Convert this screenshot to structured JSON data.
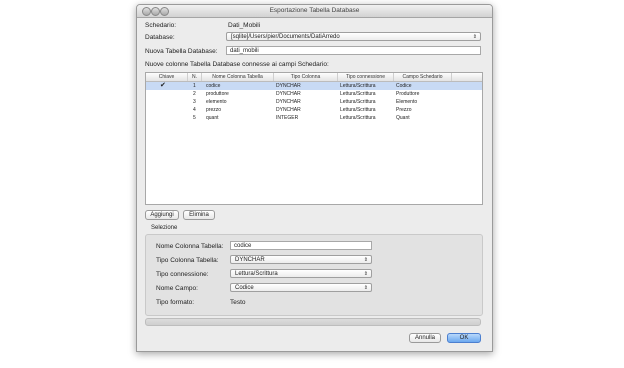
{
  "window": {
    "title": "Esportazione Tabella Database"
  },
  "form": {
    "schedario_label": "Schedario:",
    "schedario_value": "Dati_Mobili",
    "database_label": "Database:",
    "database_value": "[sqlite]/Users/pier/Documents/DatiArredo",
    "new_table_label": "Nuova Tabella Database:",
    "new_table_value": "dati_mobili",
    "columns_caption": "Nuove colonne Tabella Database connesse ai campi Schedario:"
  },
  "table": {
    "headers": [
      "Chiave",
      "N.",
      "Nome Colonna Tabella",
      "Tipo Colonna",
      "Tipo connessione",
      "Campo Schedario"
    ],
    "rows": [
      {
        "key": "✔",
        "n": "1",
        "name": "codice",
        "type": "DYNCHAR",
        "conn": "Lettura/Scrittura",
        "field": "Codice"
      },
      {
        "key": "",
        "n": "2",
        "name": "produttore",
        "type": "DYNCHAR",
        "conn": "Lettura/Scrittura",
        "field": "Produttore"
      },
      {
        "key": "",
        "n": "3",
        "name": "elemento",
        "type": "DYNCHAR",
        "conn": "Lettura/Scrittura",
        "field": "Elemento"
      },
      {
        "key": "",
        "n": "4",
        "name": "prezzo",
        "type": "DYNCHAR",
        "conn": "Lettura/Scrittura",
        "field": "Prezzo"
      },
      {
        "key": "",
        "n": "5",
        "name": "quant",
        "type": "INTEGER",
        "conn": "Lettura/Scrittura",
        "field": "Quant"
      }
    ],
    "selected_row": 0
  },
  "buttons": {
    "add": "Aggiungi",
    "remove": "Elimina",
    "cancel": "Annulla",
    "ok": "OK"
  },
  "selection": {
    "title": "Selezione",
    "col_name_label": "Nome Colonna Tabella:",
    "col_name_value": "codice",
    "col_type_label": "Tipo Colonna Tabella:",
    "col_type_value": "DYNCHAR",
    "conn_type_label": "Tipo connessione:",
    "conn_type_value": "Lettura/Scrittura",
    "field_name_label": "Nome Campo:",
    "field_name_value": "Codice",
    "format_label": "Tipo formato:",
    "format_value": "Testo"
  },
  "colors": {
    "selection": "#c8daf4",
    "ok_button": "#6ba8ef",
    "background": "#ececec"
  }
}
